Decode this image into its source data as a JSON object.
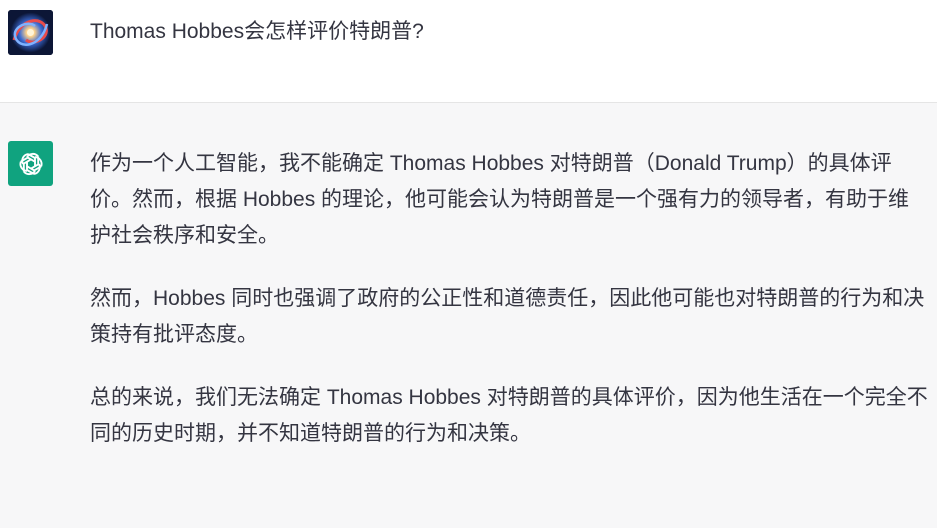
{
  "user_message": {
    "avatar_icon": "galaxy-avatar-icon",
    "text": "Thomas Hobbes会怎样评价特朗普?"
  },
  "assistant_message": {
    "avatar_icon": "openai-logo-icon",
    "accent_color": "#10a37f",
    "paragraphs": [
      "作为一个人工智能，我不能确定 Thomas Hobbes 对特朗普（Donald Trump）的具体评价。然而，根据 Hobbes 的理论，他可能会认为特朗普是一个强有力的领导者，有助于维护社会秩序和安全。",
      "然而，Hobbes 同时也强调了政府的公正性和道德责任，因此他可能也对特朗普的行为和决策持有批评态度。",
      "总的来说，我们无法确定 Thomas Hobbes 对特朗普的具体评价，因为他生活在一个完全不同的历史时期，并不知道特朗普的行为和决策。"
    ]
  }
}
